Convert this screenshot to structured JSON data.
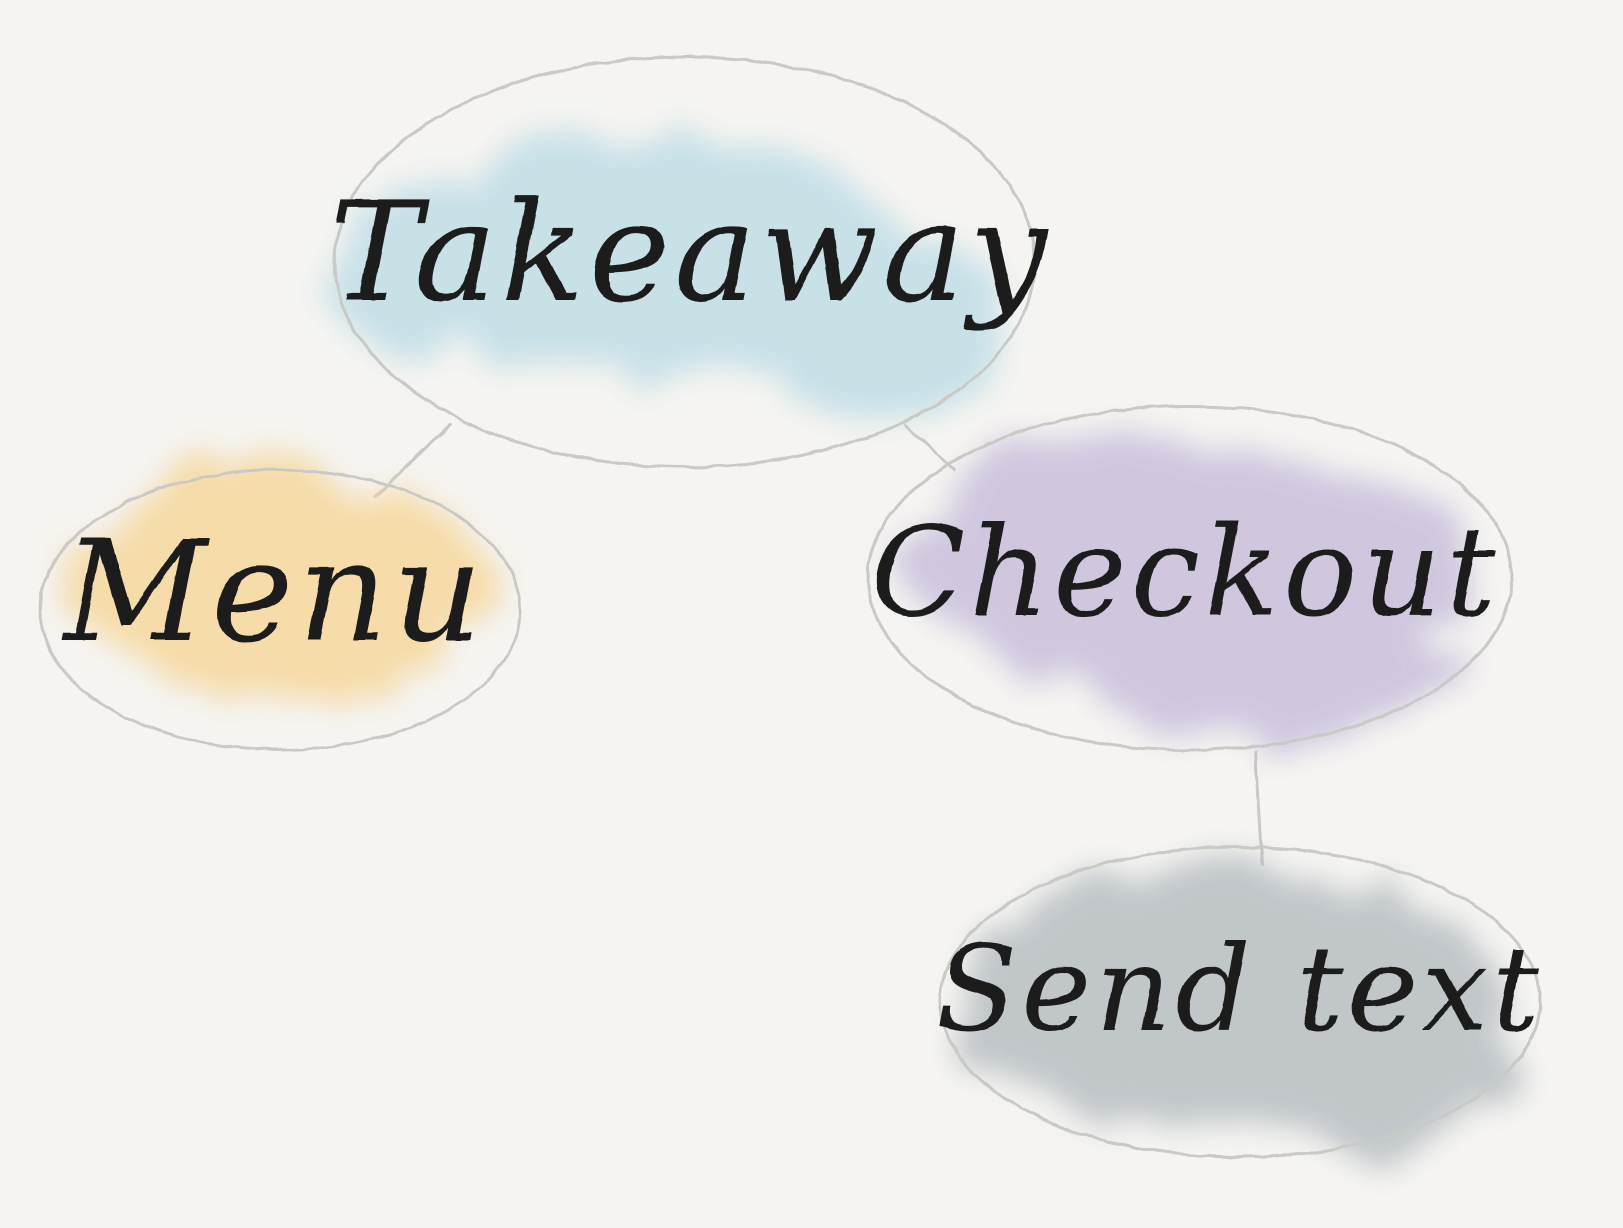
{
  "diagram": {
    "nodes": [
      {
        "id": "takeaway",
        "label": "Takeaway",
        "color": "#bfdde6"
      },
      {
        "id": "menu",
        "label": "Menu",
        "color": "#f6d79c"
      },
      {
        "id": "checkout",
        "label": "Checkout",
        "color": "#c9bfdc"
      },
      {
        "id": "send-text",
        "label": "Send text",
        "color": "#b7bec2"
      }
    ],
    "edges": [
      {
        "from": "takeaway",
        "to": "menu"
      },
      {
        "from": "takeaway",
        "to": "checkout"
      },
      {
        "from": "checkout",
        "to": "send-text"
      }
    ],
    "colors": {
      "background": "#f5f4f1",
      "outline": "#c9c9c6",
      "ink": "#1c1c1c"
    }
  }
}
